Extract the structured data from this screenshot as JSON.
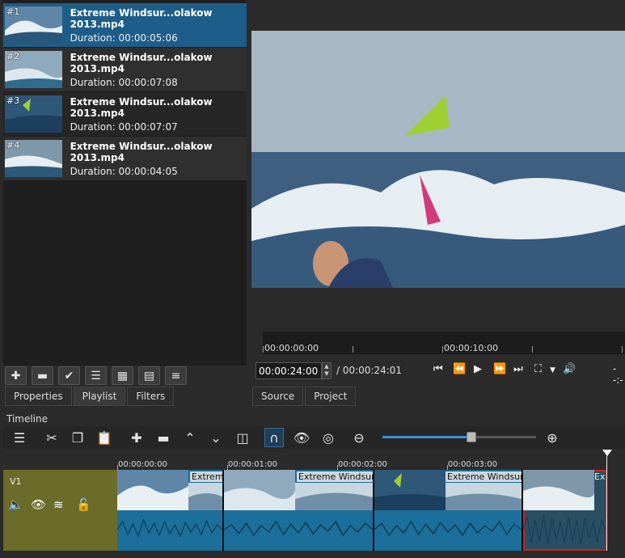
{
  "playlist": {
    "items": [
      {
        "num": "#1",
        "name": "Extreme Windsur...olakow 2013.mp4",
        "duration": "Duration: 00:00:05:06"
      },
      {
        "num": "#2",
        "name": "Extreme Windsur...olakow 2013.mp4",
        "duration": "Duration: 00:00:07:08"
      },
      {
        "num": "#3",
        "name": "Extreme Windsur...olakow 2013.mp4",
        "duration": "Duration: 00:00:07:07"
      },
      {
        "num": "#4",
        "name": "Extreme Windsur...olakow 2013.mp4",
        "duration": "Duration: 00:00:04:05"
      }
    ],
    "toolbar_icons": [
      "plus-icon",
      "minus-icon",
      "check-icon",
      "list-icon",
      "grid-icon",
      "details-icon",
      "menu-icon"
    ]
  },
  "left_tabs": [
    "Properties",
    "Playlist",
    "Filters"
  ],
  "right_tabs": [
    "Source",
    "Project"
  ],
  "player": {
    "ruler_labels": [
      "00:00:00:00",
      "00:00:10:00"
    ],
    "current_time": "00:00:24:00",
    "total_time": "/ 00:00:24:01",
    "right_fragment": "--:-"
  },
  "timeline": {
    "label": "Timeline",
    "ruler_labels": [
      "00:00:00:00",
      "00:00:01:00",
      "00:00:02:00",
      "00:00:03:00"
    ],
    "zoom_fraction": 0.58,
    "track": {
      "name": "V1"
    },
    "clips": [
      {
        "title": "Extreme",
        "selected": false
      },
      {
        "title": "Extreme Windsurfin",
        "selected": false
      },
      {
        "title": "Extreme Windsurfin",
        "selected": false
      },
      {
        "title": "Ext",
        "selected": true
      }
    ]
  },
  "colors": {
    "accent": "#3a8fd6",
    "selection": "#1d5d8a",
    "clip": "#1b6f9a",
    "track_header": "#6b6b2a"
  }
}
